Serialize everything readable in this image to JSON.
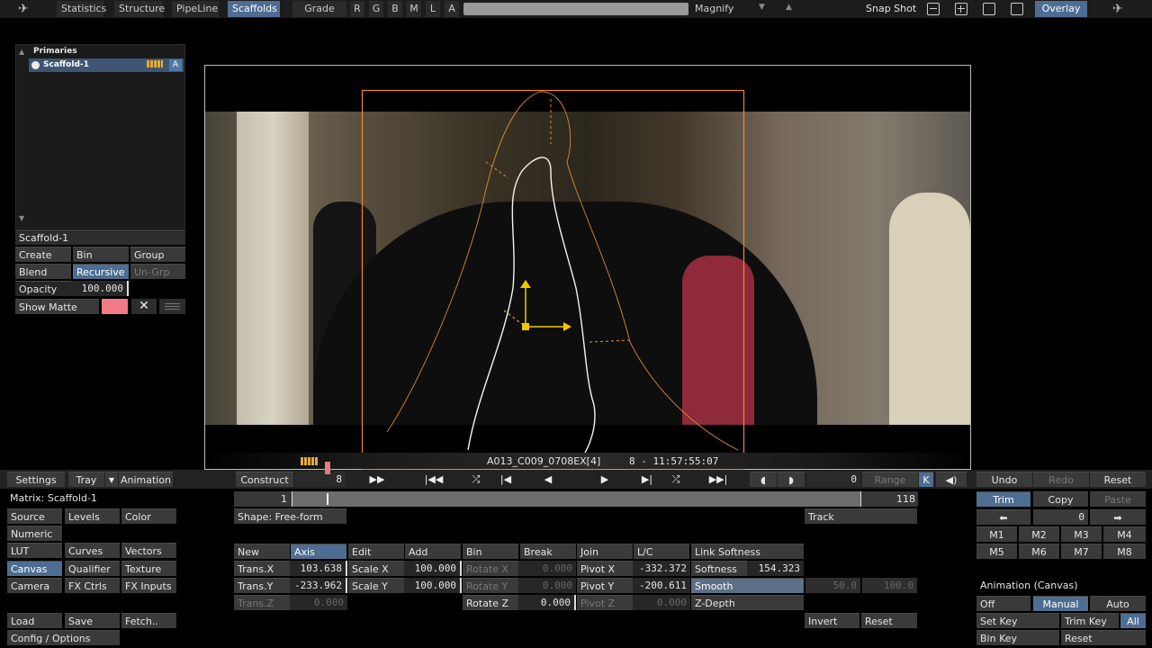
{
  "topbar": {
    "tabs": [
      "Statistics",
      "Structure",
      "PipeLine",
      "Scaffolds"
    ],
    "active_tab": "Scaffolds",
    "grade": "Grade",
    "channels": [
      "R",
      "G",
      "B",
      "M",
      "L",
      "A"
    ],
    "magnify": "Magnify",
    "snapshot": "Snap Shot",
    "overlay": "Overlay"
  },
  "scaffold_panel": {
    "header": "Primaries",
    "item": "Scaffold-1",
    "item_badge": "A",
    "name": "Scaffold-1",
    "buttons": {
      "create": "Create",
      "bin": "Bin",
      "group": "Group",
      "blend": "Blend",
      "recursive": "Recursive",
      "ungrp": "Un-Grp"
    },
    "opacity_label": "Opacity",
    "opacity_value": "100.000",
    "show_matte": "Show Matte",
    "matte_color": "#f07a86"
  },
  "viewer": {
    "clip_name": "A013_C009_0708EX[4]",
    "timecode": "8  -  11:57:55:07"
  },
  "transport": {
    "settings": "Settings",
    "tray": "Tray",
    "animation": "Animation",
    "construct": "Construct",
    "frame": "8",
    "counter": "0",
    "range": "Range",
    "k": "K",
    "undo": "Undo",
    "redo": "Redo",
    "reset": "Reset",
    "scrub_start": "1",
    "scrub_end": "118"
  },
  "left_menu": {
    "matrix": "Matrix: Scaffold-1",
    "items": [
      "Source",
      "Levels",
      "Color",
      "Numeric",
      "LUT",
      "Curves",
      "Vectors",
      "Canvas",
      "Qualifier",
      "Texture",
      "Camera",
      "FX Ctrls",
      "FX Inputs",
      "Load",
      "Save",
      "Fetch..",
      "Config / Options"
    ]
  },
  "shape": {
    "type": "Shape: Free-form",
    "track": "Track",
    "new": "New",
    "axis": "Axis",
    "edit": "Edit",
    "add": "Add",
    "bin": "Bin",
    "break": "Break",
    "join": "Join",
    "lc": "L/C",
    "link_softness": "Link Softness",
    "trans_x_label": "Trans.X",
    "trans_x": "103.638",
    "trans_y_label": "Trans.Y",
    "trans_y": "-233.962",
    "trans_z_label": "Trans.Z",
    "trans_z": "0.000",
    "scale_x_label": "Scale X",
    "scale_x": "100.000",
    "scale_y_label": "Scale Y",
    "scale_y": "100.000",
    "rotate_x_label": "Rotate X",
    "rotate_x": "0.000",
    "rotate_y_label": "Rotate Y",
    "rotate_y": "0.000",
    "rotate_z_label": "Rotate Z",
    "rotate_z": "0.000",
    "pivot_x_label": "Pivot X",
    "pivot_x": "-332.372",
    "pivot_y_label": "Pivot Y",
    "pivot_y": "-200.611",
    "pivot_z_label": "Pivot Z",
    "pivot_z": "0.000",
    "softness_label": "Softness",
    "softness": "154.323",
    "smooth": "Smooth",
    "z_depth": "Z-Depth",
    "smooth_a": "50.0",
    "smooth_b": "100.0",
    "invert": "Invert",
    "reset": "Reset"
  },
  "right_panel": {
    "trim": "Trim",
    "copy": "Copy",
    "paste": "Paste",
    "index": "0",
    "m": [
      "M1",
      "M2",
      "M3",
      "M4",
      "M5",
      "M6",
      "M7",
      "M8"
    ],
    "anim_title": "Animation (Canvas)",
    "off": "Off",
    "manual": "Manual",
    "auto": "Auto",
    "set_key": "Set Key",
    "trim_key": "Trim Key",
    "all": "All",
    "bin_key": "Bin Key",
    "reset": "Reset"
  }
}
